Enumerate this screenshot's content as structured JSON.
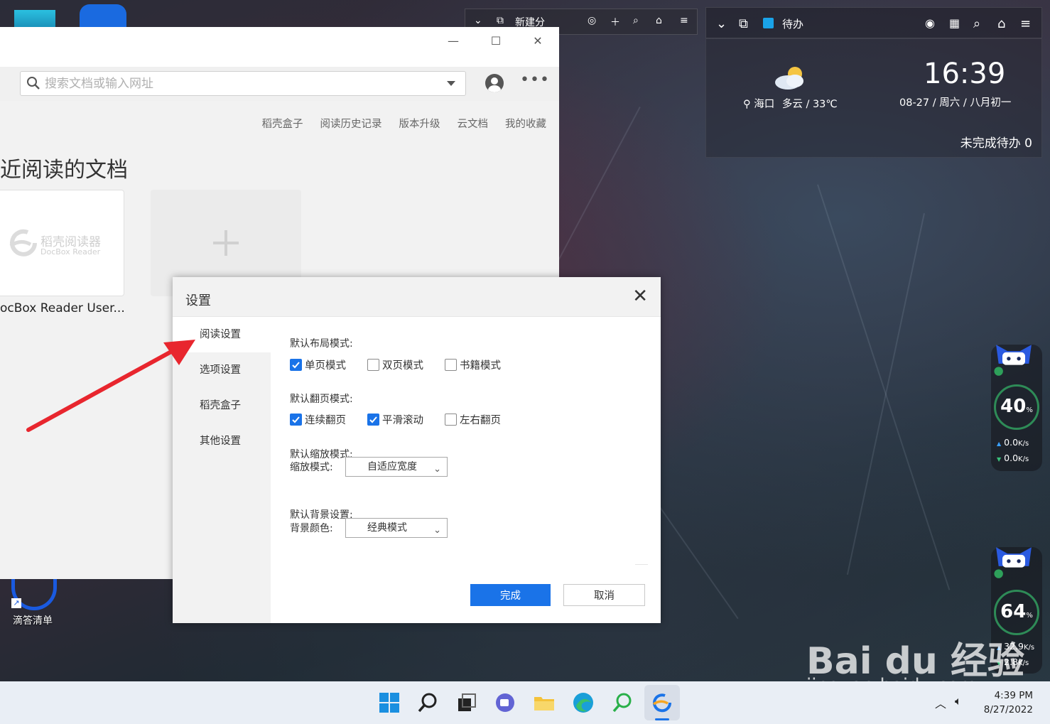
{
  "app": {
    "window_controls": {
      "minimize": "—",
      "maximize": "☐",
      "close": "✕"
    },
    "search": {
      "placeholder": "搜索文档或输入网址"
    },
    "nav_links": [
      "稻壳盒子",
      "阅读历史记录",
      "版本升级",
      "云文档",
      "我的收藏"
    ],
    "section_title": "近阅读的文档",
    "recent_doc": {
      "logo_title": "稻壳阅读器",
      "logo_subtitle": "DocBox Reader",
      "name": "ocBox Reader User..."
    }
  },
  "dialog": {
    "title": "设置",
    "close": "✕",
    "sidebar": [
      {
        "label": "阅读设置",
        "active": true
      },
      {
        "label": "选项设置",
        "active": false
      },
      {
        "label": "稻壳盒子",
        "active": false
      },
      {
        "label": "其他设置",
        "active": false
      }
    ],
    "layout": {
      "label": "默认布局模式:",
      "options": [
        {
          "label": "单页模式",
          "checked": true
        },
        {
          "label": "双页模式",
          "checked": false
        },
        {
          "label": "书籍模式",
          "checked": false
        }
      ]
    },
    "page_turn": {
      "label": "默认翻页模式:",
      "options": [
        {
          "label": "连续翻页",
          "checked": true
        },
        {
          "label": "平滑滚动",
          "checked": true
        },
        {
          "label": "左右翻页",
          "checked": false
        }
      ]
    },
    "zoom": {
      "label": "默认缩放模式:",
      "field_label": "缩放模式:",
      "value": "自适应宽度"
    },
    "background": {
      "label": "默认背景设置:",
      "field_label": "背景颜色:",
      "value": "经典模式"
    },
    "done_label": "完成",
    "cancel_label": "取消",
    "accent_color": "#1a73e8"
  },
  "desktop": {
    "small_bar": {
      "new_label": "新建分"
    },
    "widget": {
      "todo_tab": "待办",
      "location": "海口",
      "weather": "多云 / 33℃",
      "time": "16:39",
      "date": "08-27 / 周六 / 八月初一",
      "todo_pending": "未完成待办 0"
    },
    "speed_monitors": [
      {
        "percent": "40",
        "unit": "%",
        "up": "0.0",
        "down": "0.0",
        "rate_unit": "K/s"
      },
      {
        "percent": "64",
        "unit": "%",
        "up": "32.9",
        "down": "2.8",
        "rate_unit": "K/s"
      }
    ],
    "icon_label": "滴答清单",
    "watermark": {
      "brand": "Bai du 经验",
      "url": "jingyan.baidu.com"
    }
  },
  "taskbar": {
    "time": "4:39 PM",
    "date": "8/27/2022",
    "apps": [
      "start",
      "search",
      "task-view",
      "teams-chat",
      "file-explorer",
      "edge",
      "search-app",
      "docbox-reader"
    ]
  }
}
